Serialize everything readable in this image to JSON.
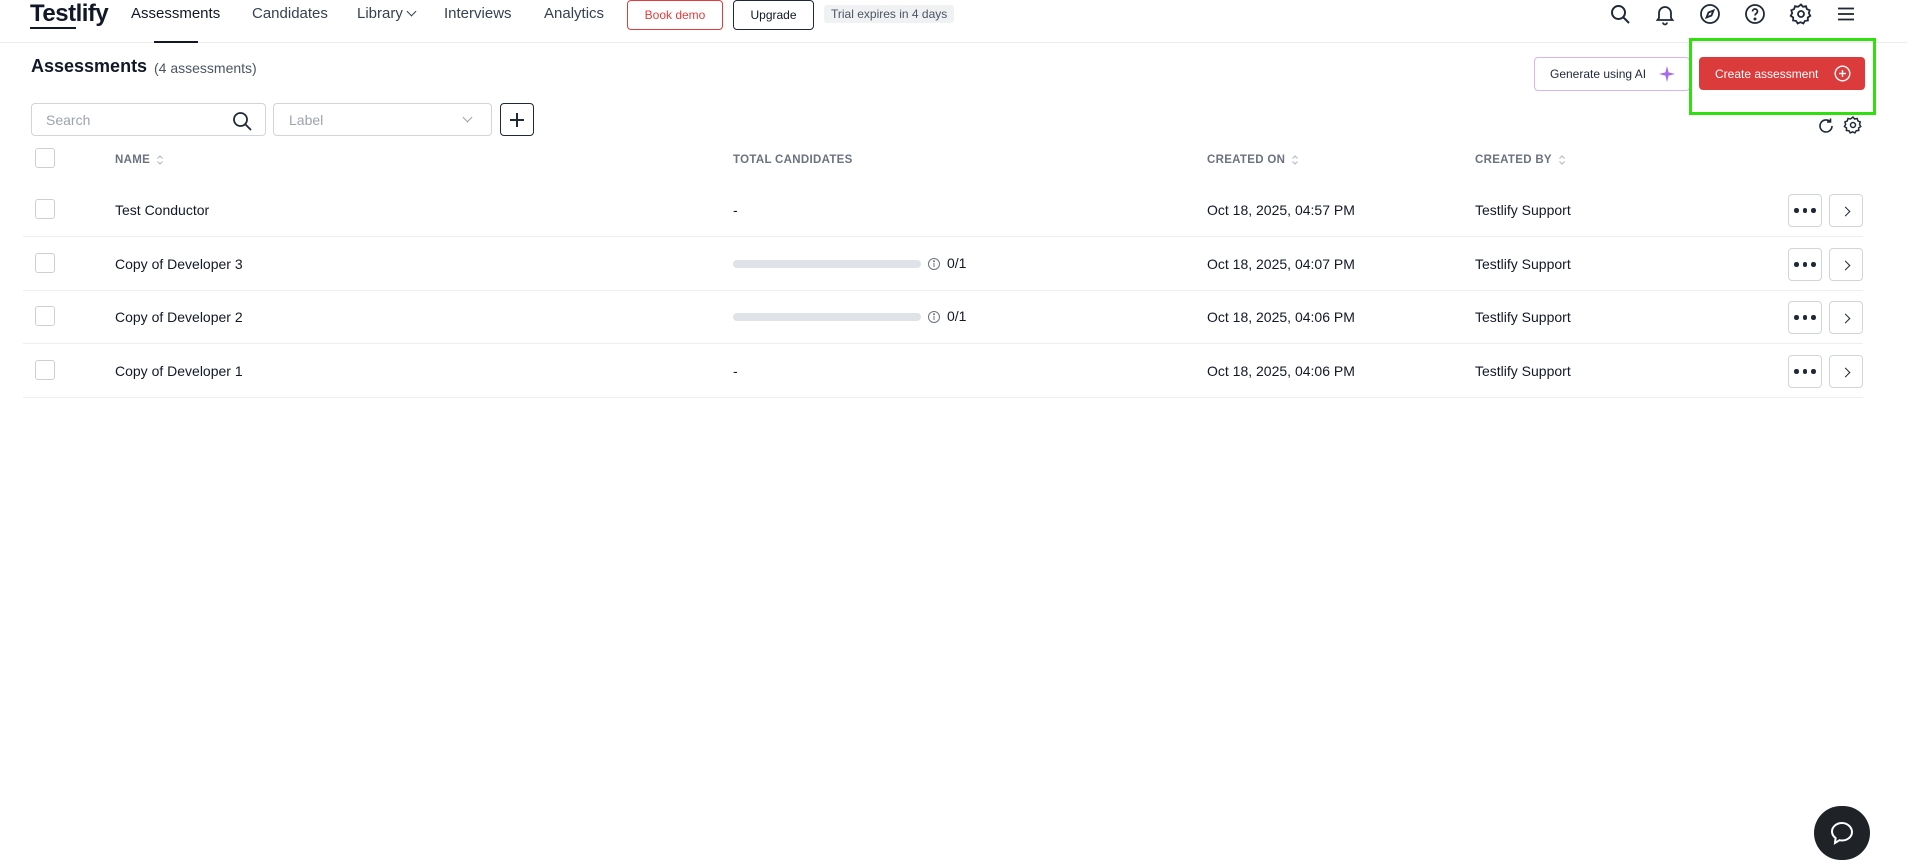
{
  "app": {
    "logo_text": "Testlify",
    "brand_color": "#dc3b3b"
  },
  "nav": {
    "items": [
      {
        "label": "Assessments",
        "active": true
      },
      {
        "label": "Candidates"
      },
      {
        "label": "Library"
      },
      {
        "label": "Interviews"
      },
      {
        "label": "Analytics"
      }
    ],
    "book_demo_label": "Book demo",
    "upgrade_label": "Upgrade",
    "trial_text": "Trial expires in 4 days",
    "icons": [
      "search-icon",
      "bell-icon",
      "compass-icon",
      "help-icon",
      "gear-icon",
      "menu-icon"
    ]
  },
  "page": {
    "title": "Assessments",
    "count_text": "(4 assessments)",
    "generate_ai_label": "Generate using AI",
    "create_label": "Create assessment"
  },
  "filters": {
    "search_placeholder": "Search",
    "label_placeholder": "Label"
  },
  "table": {
    "headers": {
      "name": "NAME",
      "total_candidates": "TOTAL CANDIDATES",
      "created_on": "CREATED ON",
      "created_by": "CREATED BY"
    },
    "rows": [
      {
        "name": "Test Conductor",
        "candidates": "-",
        "progress": null,
        "created_on": "Oct 18, 2025, 04:57 PM",
        "created_by": "Testlify Support"
      },
      {
        "name": "Copy of Developer 3",
        "candidates": "0/1",
        "progress": 0,
        "created_on": "Oct 18, 2025, 04:07 PM",
        "created_by": "Testlify Support"
      },
      {
        "name": "Copy of Developer 2",
        "candidates": "0/1",
        "progress": 0,
        "created_on": "Oct 18, 2025, 04:06 PM",
        "created_by": "Testlify Support"
      },
      {
        "name": "Copy of Developer 1",
        "candidates": "-",
        "progress": null,
        "created_on": "Oct 18, 2025, 04:06 PM",
        "created_by": "Testlify Support"
      }
    ]
  }
}
